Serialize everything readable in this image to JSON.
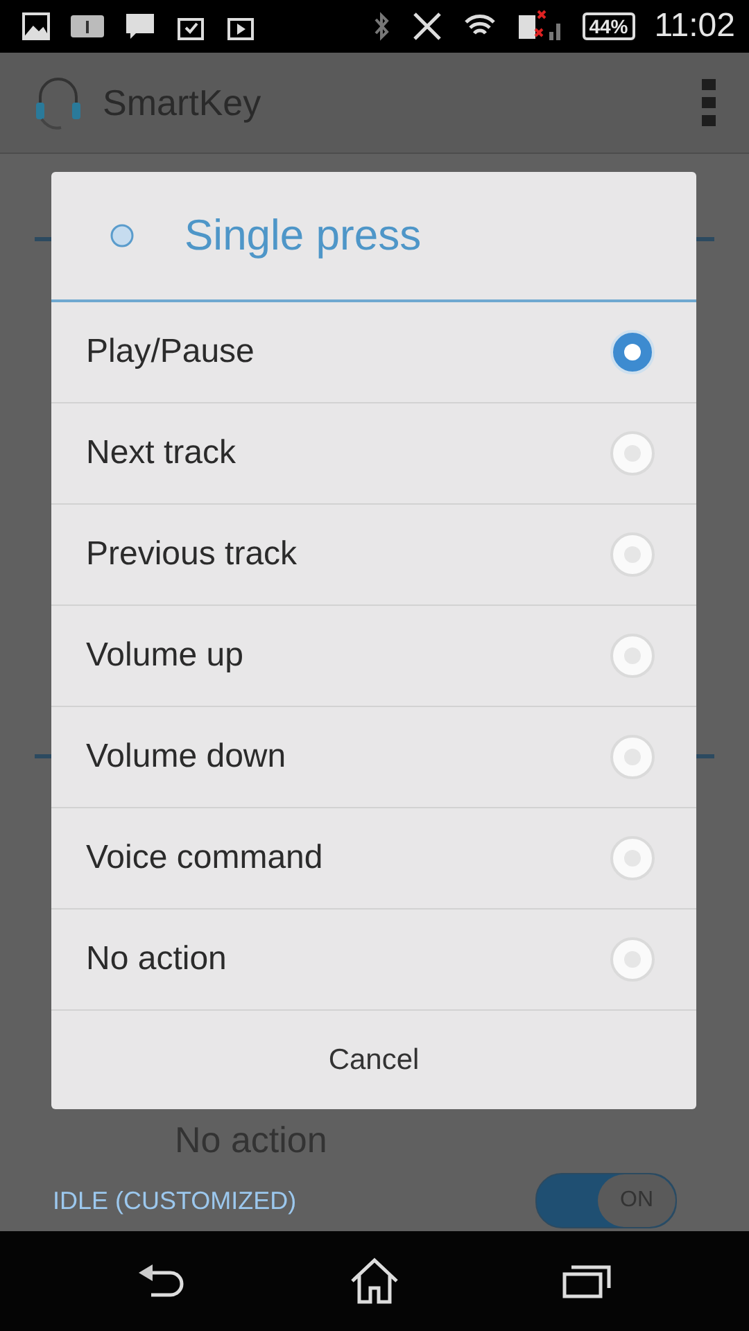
{
  "status_bar": {
    "battery": "44%",
    "time": "11:02"
  },
  "app_bar": {
    "title": "SmartKey"
  },
  "background": {
    "row_text": "No action",
    "section": {
      "label": "IDLE (CUSTOMIZED)",
      "toggle": {
        "label": "ON",
        "on": true
      }
    }
  },
  "dialog": {
    "title": "Single press",
    "options": [
      {
        "label": "Play/Pause",
        "selected": true
      },
      {
        "label": "Next track",
        "selected": false
      },
      {
        "label": "Previous track",
        "selected": false
      },
      {
        "label": "Volume up",
        "selected": false
      },
      {
        "label": "Volume down",
        "selected": false
      },
      {
        "label": "Voice command",
        "selected": false
      },
      {
        "label": "No action",
        "selected": false
      }
    ],
    "cancel": "Cancel"
  }
}
